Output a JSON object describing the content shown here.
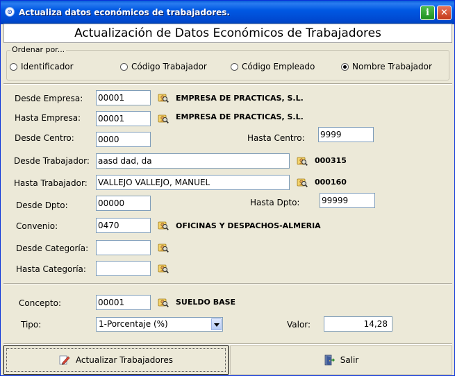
{
  "window": {
    "title": "Actualiza datos económicos de trabajadores.",
    "app_icon_glyph": "⊙",
    "info_glyph": "i",
    "close_glyph": "✕"
  },
  "header": {
    "title": "Actualización de Datos Económicos de Trabajadores"
  },
  "order": {
    "legend": "Ordenar por...",
    "options": [
      {
        "label": "Identificador",
        "selected": false
      },
      {
        "label": "Código Trabajador",
        "selected": false
      },
      {
        "label": "Código Empleado",
        "selected": false
      },
      {
        "label": "Nombre Trabajador",
        "selected": true
      }
    ]
  },
  "filters": {
    "desde_empresa": {
      "label": "Desde Empresa:",
      "value": "00001",
      "desc": "EMPRESA DE PRACTICAS, S.L."
    },
    "hasta_empresa": {
      "label": "Hasta Empresa:",
      "value": "00001",
      "desc": "EMPRESA DE PRACTICAS, S.L."
    },
    "desde_centro": {
      "label": "Desde Centro:",
      "value": "0000"
    },
    "hasta_centro": {
      "label": "Hasta Centro:",
      "value": "9999"
    },
    "desde_trabajador": {
      "label": "Desde Trabajador:",
      "value": "aasd dad, da",
      "desc": "000315"
    },
    "hasta_trabajador": {
      "label": "Hasta Trabajador:",
      "value": "VALLEJO VALLEJO, MANUEL",
      "desc": "000160"
    },
    "desde_dpto": {
      "label": "Desde Dpto:",
      "value": "00000"
    },
    "hasta_dpto": {
      "label": "Hasta Dpto:",
      "value": "99999"
    },
    "convenio": {
      "label": "Convenio:",
      "value": "0470",
      "desc": "OFICINAS Y DESPACHOS-ALMERIA"
    },
    "desde_categoria": {
      "label": "Desde Categoría:",
      "value": ""
    },
    "hasta_categoria": {
      "label": "Hasta Categoría:",
      "value": ""
    }
  },
  "concept": {
    "concepto": {
      "label": "Concepto:",
      "value": "00001",
      "desc": "SUELDO BASE"
    },
    "tipo": {
      "label": "Tipo:",
      "value": "1-Porcentaje (%)"
    },
    "valor": {
      "label": "Valor:",
      "value": "14,28"
    }
  },
  "buttons": {
    "update_label": "Actualizar Trabajadores",
    "exit_label": "Salir"
  },
  "icons": {
    "lookup": "search-person-icon",
    "update": "edit-pencil-icon",
    "exit": "exit-door-icon"
  },
  "colors": {
    "titlebar": "#0058e3",
    "window_bg": "#ece9d8",
    "input_border": "#7f9db9"
  }
}
